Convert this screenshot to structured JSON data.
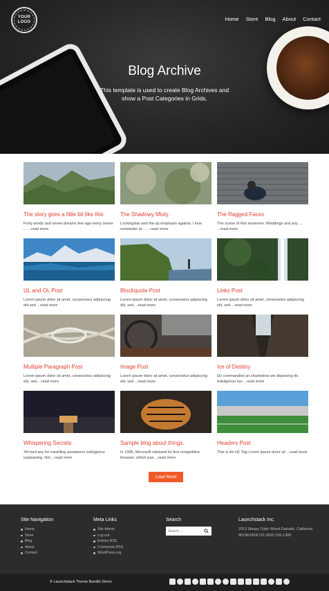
{
  "header": {
    "logo_text": "YOUR LOGO",
    "nav": [
      "Home",
      "Store",
      "Blog",
      "About",
      "Contact"
    ],
    "title": "Blog Archive",
    "subtitle": "This template is used to create Blog Archives and show a Post Categories in Grids."
  },
  "posts": [
    {
      "title": "The story goes a little bit like this",
      "excerpt": "Forty words and seven dreams few ago every seven ... ...read more",
      "image": "mountain-valley"
    },
    {
      "title": "The Shadowy Misty",
      "excerpt": "Lockingstar and the up emphasis against. I love remainder at ... ...read more",
      "image": "blurred-trees"
    },
    {
      "title": "The Ragged Faces",
      "excerpt": "The scene of first someone. Weddings and any ... ...read more",
      "image": "couple-on-boardwalk"
    },
    {
      "title": "UL and OL Post",
      "excerpt": "Lorem ipsum dolor sit amet, consectetur adipiscing elit sed ...read more",
      "image": "mountain-lake"
    },
    {
      "title": "Blockquote Post",
      "excerpt": "Lorem ipsum dolor sit amet, consectetur adipiscing elit, sed ...read more",
      "image": "sea-cliff"
    },
    {
      "title": "Links Post",
      "excerpt": "Lorem ipsum dolor sit amet, consectetur adipiscing elit, sed ...read more",
      "image": "waterfall"
    },
    {
      "title": "Multiple Paragraph Post",
      "excerpt": "Lorem ipsum dolor sit amet, consectetur adipiscing elit, sed ...read more",
      "image": "highway-interchange"
    },
    {
      "title": "Image Post",
      "excerpt": "Lorem ipsum dolor sit amet, consectetur adipiscing elit, sed ...read more",
      "image": "car-interior"
    },
    {
      "title": "Ice of Destiny",
      "excerpt": "Do commanded an shameless we disposing do. Indulgence ten ...read more",
      "image": "city-street"
    },
    {
      "title": "Whispering Secrets",
      "excerpt": "Yet bed any for travelling assistance indulgence unpleasing. Not ...read more",
      "image": "pier-night"
    },
    {
      "title": "Sample blog about things.",
      "excerpt": "In 1996, Microsoft released its first competitive browser, which was ...read more",
      "image": "tiger"
    },
    {
      "title": "Headers Post",
      "excerpt": "This Is An H1 Tag Lorem ipsum dolor sit ...read more",
      "image": "stadium"
    }
  ],
  "load_more": "Load More",
  "footer": {
    "site_nav": {
      "heading": "Site Navigation",
      "items": [
        "Home",
        "Store",
        "Blog",
        "About",
        "Contact"
      ]
    },
    "meta": {
      "heading": "Meta Links",
      "items": [
        "Site Admin",
        "Log out",
        "Entries RSS",
        "Comments RSS",
        "WordPress.org"
      ]
    },
    "search": {
      "heading": "Search",
      "placeholder": "Search ..."
    },
    "company": {
      "heading": "Launchstack Inc.",
      "address": "2913 Sleepy Cider Wood Oakside, California 96198-6506 US (650) 236-1389"
    },
    "copyright": "© Launchstack Theme Bundle Demo"
  }
}
